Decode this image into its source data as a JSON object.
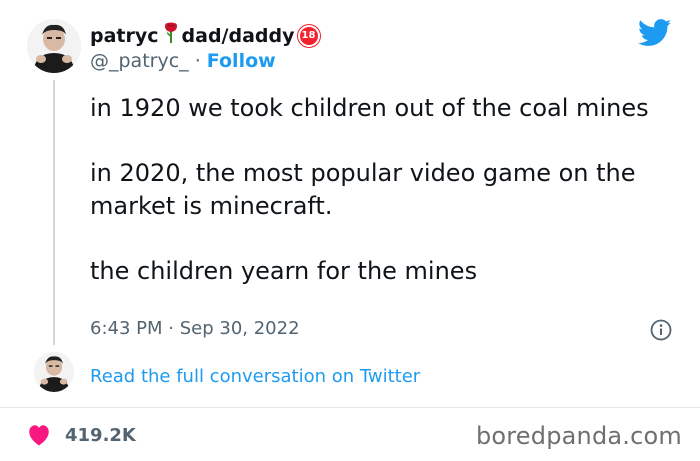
{
  "author": {
    "name_part1": "patryc",
    "rose_emoji": "🌹",
    "name_part2": "dad/daddy",
    "badge": "18",
    "handle": "@_patryc_",
    "separator": "·",
    "follow_label": "Follow"
  },
  "tweet": {
    "paragraphs": [
      "in 1920 we took children out of the coal mines",
      "in 2020, the most popular video game on the market is minecraft.",
      "the children yearn for the mines"
    ],
    "time": "6:43 PM",
    "meta_separator": "·",
    "date": "Sep 30, 2022"
  },
  "conversation_link": "Read the full conversation on Twitter",
  "likes": {
    "count": "419.2K"
  },
  "watermark": "boredpanda.com",
  "colors": {
    "twitter_blue": "#1d9bf0",
    "like_red": "#f91880",
    "badge_red": "#f4212e",
    "muted": "#536471"
  },
  "icons": [
    "avatar",
    "rose-icon",
    "eighteen-badge-icon",
    "twitter-bird-icon",
    "info-icon",
    "heart-icon"
  ]
}
